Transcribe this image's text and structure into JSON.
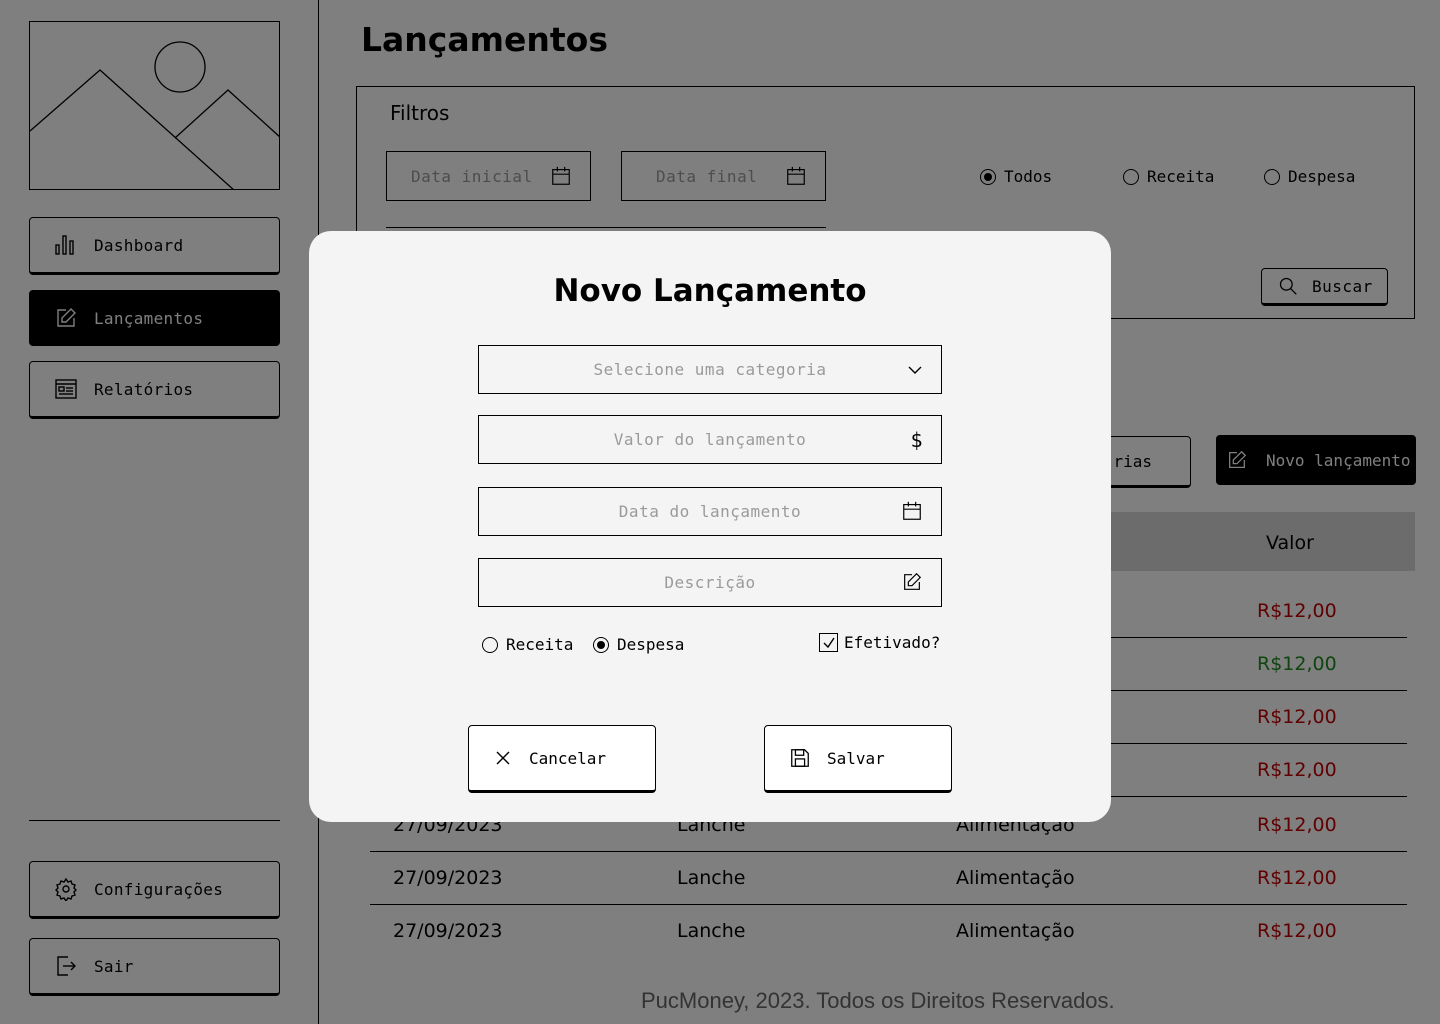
{
  "sidebar": {
    "items": [
      {
        "label": "Dashboard",
        "icon": "bar-chart-icon"
      },
      {
        "label": "Lançamentos",
        "icon": "edit-icon",
        "active": true
      },
      {
        "label": "Relatórios",
        "icon": "report-icon"
      }
    ],
    "bottom": [
      {
        "label": "Configurações",
        "icon": "gear-icon"
      },
      {
        "label": "Sair",
        "icon": "logout-icon"
      }
    ]
  },
  "page": {
    "title": "Lançamentos",
    "filters": {
      "title": "Filtros",
      "start_date_placeholder": "Data inicial",
      "end_date_placeholder": "Data final",
      "type_options": [
        {
          "label": "Todos",
          "selected": true
        },
        {
          "label": "Receita",
          "selected": false
        },
        {
          "label": "Despesa",
          "selected": false
        }
      ],
      "search_label": "Buscar"
    },
    "categories_button_partial": "rias",
    "new_entry_label": "Novo lançamento",
    "table": {
      "header_valor": "Valor",
      "hidden_rows_values": [
        {
          "valor": "R$12,00",
          "color": "#c00000"
        },
        {
          "valor": "R$12,00",
          "color": "#1f8a1f"
        },
        {
          "valor": "R$12,00",
          "color": "#c00000"
        },
        {
          "valor": "R$12,00",
          "color": "#c00000"
        }
      ],
      "rows": [
        {
          "data": "27/09/2023",
          "descricao": "Lanche",
          "categoria": "Alimentação",
          "valor": "R$12,00"
        },
        {
          "data": "27/09/2023",
          "descricao": "Lanche",
          "categoria": "Alimentação",
          "valor": "R$12,00"
        },
        {
          "data": "27/09/2023",
          "descricao": "Lanche",
          "categoria": "Alimentação",
          "valor": "R$12,00"
        }
      ]
    },
    "footer": "PucMoney, 2023. Todos os Direitos Reservados."
  },
  "modal": {
    "title": "Novo Lançamento",
    "category_placeholder": "Selecione uma categoria",
    "value_placeholder": "Valor do lançamento",
    "date_placeholder": "Data do lançamento",
    "description_placeholder": "Descrição",
    "type_options": [
      {
        "label": "Receita",
        "selected": false
      },
      {
        "label": "Despesa",
        "selected": true
      }
    ],
    "effected_label": "Efetivado?",
    "effected_checked": true,
    "cancel_label": "Cancelar",
    "save_label": "Salvar"
  },
  "colors": {
    "expense": "#c00000",
    "income": "#1f8a1f",
    "overlay": "rgba(0,0,0,0.5)",
    "modal_bg": "#f4f4f4"
  }
}
